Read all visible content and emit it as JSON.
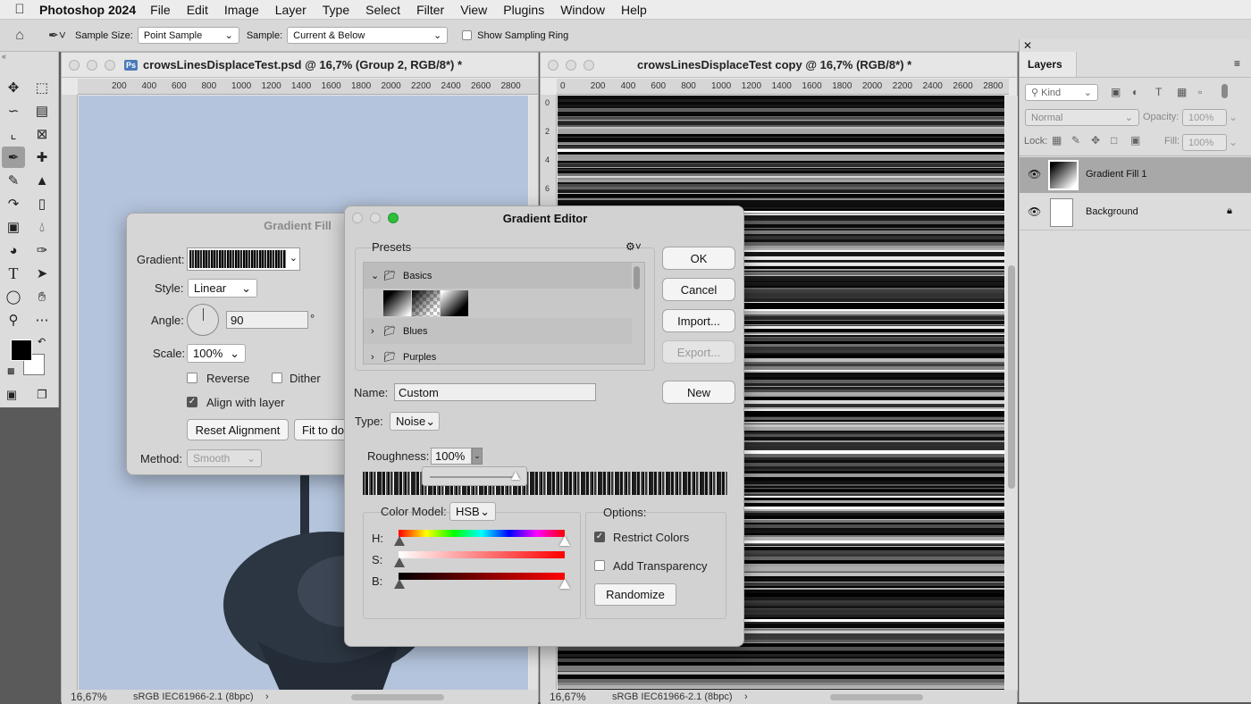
{
  "menubar": {
    "app": "Photoshop 2024",
    "items": [
      "File",
      "Edit",
      "Image",
      "Layer",
      "Type",
      "Select",
      "Filter",
      "View",
      "Plugins",
      "Window",
      "Help"
    ]
  },
  "options": {
    "sample_size_label": "Sample Size:",
    "sample_size": "Point Sample",
    "sample_label": "Sample:",
    "sample": "Current & Below",
    "sampling_ring": "Show Sampling Ring"
  },
  "doc1": {
    "title": "crowsLinesDisplaceTest.psd @ 16,7% (Group 2, RGB/8*) *",
    "ruler": [
      "200",
      "400",
      "600",
      "800",
      "1000",
      "1200",
      "1400",
      "1600",
      "1800",
      "2000",
      "2200",
      "2400",
      "2600",
      "2800"
    ],
    "zoom": "16,67%",
    "profile": "sRGB IEC61966-2.1 (8bpc)"
  },
  "doc2": {
    "title": "crowsLinesDisplaceTest copy @ 16,7% (RGB/8*) *",
    "ruler": [
      "0",
      "200",
      "400",
      "600",
      "800",
      "1000",
      "1200",
      "1400",
      "1600",
      "1800",
      "2000",
      "2200",
      "2400",
      "2600",
      "2800"
    ],
    "vruler": [
      "0",
      "2",
      "4",
      "6"
    ],
    "zoom": "16,67%",
    "profile": "sRGB IEC61966-2.1 (8bpc)"
  },
  "layers": {
    "title": "Layers",
    "kind": "Kind",
    "blend": "Normal",
    "opacity_label": "Opacity:",
    "opacity": "100%",
    "lock_label": "Lock:",
    "fill_label": "Fill:",
    "fill": "100%",
    "items": [
      {
        "name": "Gradient Fill 1"
      },
      {
        "name": "Background"
      }
    ]
  },
  "gradient_fill": {
    "title": "Gradient Fill",
    "gradient_label": "Gradient:",
    "style_label": "Style:",
    "style": "Linear",
    "angle_label": "Angle:",
    "angle": "90",
    "angle_unit": "°",
    "scale_label": "Scale:",
    "scale": "100%",
    "reverse": "Reverse",
    "dither": "Dither",
    "align": "Align with layer",
    "reset": "Reset Alignment",
    "fit": "Fit to do",
    "method_label": "Method:",
    "method": "Smooth"
  },
  "editor": {
    "title": "Gradient Editor",
    "presets_label": "Presets",
    "folders": [
      "Basics",
      "Blues",
      "Purples"
    ],
    "ok": "OK",
    "cancel": "Cancel",
    "import": "Import...",
    "export": "Export...",
    "new": "New",
    "name_label": "Name:",
    "name": "Custom",
    "type_label": "Type:",
    "type": "Noise",
    "roughness_label": "Roughness:",
    "roughness": "100%",
    "color_model_label": "Color Model:",
    "color_model": "HSB",
    "h": "H:",
    "s": "S:",
    "b": "B:",
    "options_label": "Options:",
    "restrict": "Restrict Colors",
    "transparency": "Add Transparency",
    "randomize": "Randomize",
    "restrict_checked": true,
    "transparency_checked": false
  }
}
